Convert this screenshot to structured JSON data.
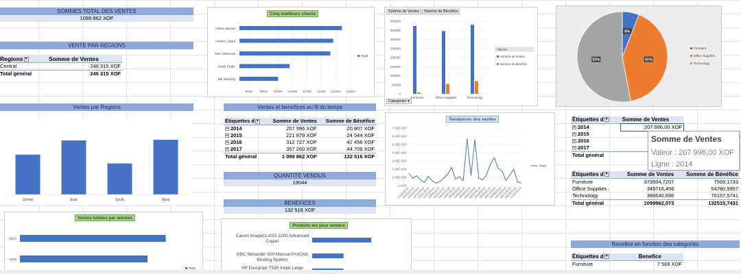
{
  "total_sales": {
    "banner": "SOMMES TOTAL DES VENTES",
    "value": "1099 862 XOF"
  },
  "region_sales": {
    "banner": "VENTE PAR REGIONS",
    "header": [
      "Regions",
      "Somme de Ventes"
    ],
    "rows": [
      {
        "label": "Central",
        "value": "246 315 XOF"
      }
    ],
    "total": {
      "label": "Total général",
      "value": "246 315 XOF"
    }
  },
  "top_clients_chart": {
    "title": "Cinq meilleurs clients",
    "legend": "Total",
    "colors": {
      "bar": "#4472c4"
    },
    "chart_data": {
      "type": "bar",
      "categories": [
        "Adrian Barton",
        "Hunter Lopez",
        "Tom Ashbrook",
        "Sanjit Engle",
        "Bill Shonely"
      ],
      "values": [
        12200,
        11900,
        11800,
        10400,
        10000
      ],
      "xlim": [
        9000,
        12500
      ],
      "xticks": [
        "9000",
        "9500",
        "10000",
        "10500",
        "11000",
        "11500",
        "12000",
        "12500"
      ]
    }
  },
  "cat_compare_chart": {
    "tabs": [
      "Somme de Ventes",
      "Somme de Bénéfice"
    ],
    "legend_title": "Valeurs",
    "legend": [
      "Somme de Ventes",
      "Somme de Bénéfice"
    ],
    "filter_label": "Categories",
    "colors": {
      "ventes": "#4472c4",
      "benefice": "#ed7d31"
    },
    "chart_data": {
      "type": "bar",
      "categories": [
        "Furniture",
        "Office Supplies",
        "Technology"
      ],
      "series": [
        {
          "name": "Somme de Ventes",
          "values": [
            373504,
            345716,
            380640
          ]
        },
        {
          "name": "Somme de Bénéfice",
          "values": [
            7569,
            54780,
            70157
          ]
        }
      ],
      "ylim": [
        0,
        400000
      ],
      "yticks": [
        "0",
        "50000",
        "100000",
        "150000",
        "200000",
        "250000",
        "300000",
        "350000",
        "400000"
      ]
    }
  },
  "pie_chart": {
    "labels_shown": [
      "6%",
      "41%",
      "53%"
    ],
    "legend": [
      "Furniture",
      "Office Supplies",
      "Technology"
    ],
    "colors": {
      "Furniture": "#4472c4",
      "Office Supplies": "#ed7d31",
      "Technology": "#a5a5a5"
    },
    "chart_data": {
      "type": "pie",
      "categories": [
        "Furniture",
        "Office Supplies",
        "Technology"
      ],
      "values": [
        6,
        41,
        53
      ]
    }
  },
  "regions_chart": {
    "banner": "Ventes par Regions",
    "colors": {
      "bar": "#4472c4"
    },
    "chart_data": {
      "type": "bar",
      "categories": [
        "Central",
        "East",
        "South",
        "West"
      ],
      "values": [
        0.59,
        0.8,
        0.46,
        0.81
      ]
    }
  },
  "yearly_table": {
    "banner": "Ventes et benefices au fil du temps",
    "header": [
      "Étiquettes d",
      "Somme de Ventes",
      "Somme de Bénéfice"
    ],
    "rows": [
      {
        "label": "2014",
        "ventes": "207 996 XOF",
        "benefice": "20 807 XOF"
      },
      {
        "label": "2015",
        "ventes": "221 879 XOF",
        "benefice": "24 544 XOF"
      },
      {
        "label": "2016",
        "ventes": "312 727 XOF",
        "benefice": "42 456 XOF"
      },
      {
        "label": "2017",
        "ventes": "357 260 XOF",
        "benefice": "44 709 XOF"
      }
    ],
    "total": {
      "label": "Total général",
      "ventes": "1 099 862 XOF",
      "benefice": "132 516 XOF"
    }
  },
  "quantity": {
    "banner": "QUANTITÉ VENDUS",
    "value": "19044"
  },
  "profits": {
    "banner": "BENEFICES",
    "value": "132 516 XOF"
  },
  "trend_chart": {
    "title": "Tendances des ventes",
    "legend": "Total",
    "colors": {
      "line": "#4472c4"
    },
    "yticks": [
      "0 XOF",
      "1 000 XOF",
      "2 000 XOF",
      "3 000 XOF",
      "4 000 XOF",
      "5 000 XOF",
      "6 000 XOF",
      "7 000 XOF"
    ],
    "xticks": [
      "01/13/2014",
      "01/20/2014",
      "02/03/2014",
      "02/11/2014",
      "02/21/2014",
      "03/02/2014",
      "03/09/2014",
      "03/15/2014",
      "03/22/2014",
      "04/01/2014",
      "04/08/2014",
      "04/16/2014",
      "04/25/2014",
      "05/02/2014",
      "05/10/2014",
      "05/19/2014",
      "05/26/2014",
      "06/01/2014",
      "06/08/2014",
      "06/14/2014",
      "06/21/2014",
      "06/29/2014",
      "07/06/2014"
    ],
    "chart_data": {
      "type": "line",
      "ylim": [
        0,
        7000
      ],
      "values": [
        1500,
        900,
        1200,
        700,
        400,
        1100,
        600,
        300,
        500,
        900,
        1400,
        2200,
        800,
        1100,
        600,
        5700,
        1200,
        5600,
        900,
        700,
        1300,
        2600,
        3400,
        2100,
        1800,
        600,
        1300,
        2000,
        500,
        300
      ]
    }
  },
  "right_table": {
    "header": [
      "Étiquettes d",
      "Somme de Ventes"
    ],
    "rows": [
      {
        "label": "2014",
        "value": "207 996,00 XOF"
      },
      {
        "label": "2015",
        "value": "221"
      },
      {
        "label": "2016",
        "value": "312"
      },
      {
        "label": "2017",
        "value": "357"
      }
    ],
    "total": {
      "label": "Total général",
      "value": "1099"
    }
  },
  "tooltip": {
    "title": "Somme de Ventes",
    "value": "Valeur : 207 996,00 XOF",
    "line": "Ligne : 2014"
  },
  "category_table": {
    "header": [
      "Étiquettes d",
      "Somme de Ventes",
      "Somme de Bénéfice"
    ],
    "rows": [
      {
        "label": "Furniture",
        "ventes": "373504,7207",
        "benefice": "7569,1733"
      },
      {
        "label": "Office Supplies",
        "ventes": "345716,456",
        "benefice": "54780,9957"
      },
      {
        "label": "Technology",
        "ventes": "380640,896",
        "benefice": "70157,5741"
      }
    ],
    "total": {
      "label": "Total général",
      "ventes": "1099862,073",
      "benefice": "132515,7431"
    }
  },
  "benefit_cat_table": {
    "banner": "Benefice en fonction des categories",
    "header": [
      "Étiquettes d",
      "Benefice"
    ],
    "rows": [
      {
        "label": "Furniture",
        "value": "7 569 XOF"
      }
    ]
  },
  "yearly_total_chart": {
    "title": "Ventes totales par années",
    "legend": "Total",
    "colors": {
      "bar": "#4472c4"
    },
    "chart_data": {
      "type": "bar",
      "categories": [
        "2017",
        "2016"
      ],
      "values": [
        357260,
        312727
      ],
      "xlim": [
        0,
        400000
      ]
    }
  },
  "top_products_chart": {
    "title": "Produits les plus vendus",
    "colors": {
      "bar": "#4472c4"
    },
    "chart_data": {
      "type": "bar",
      "categories": [
        "Canon imageCLASS 2200 Advanced Copier",
        "GBC Ibimaster 500 Manual ProClick Binding System",
        "HP Designjet T520 Inkjet Large"
      ],
      "values": [
        1.0,
        0.53,
        0.53
      ]
    }
  }
}
